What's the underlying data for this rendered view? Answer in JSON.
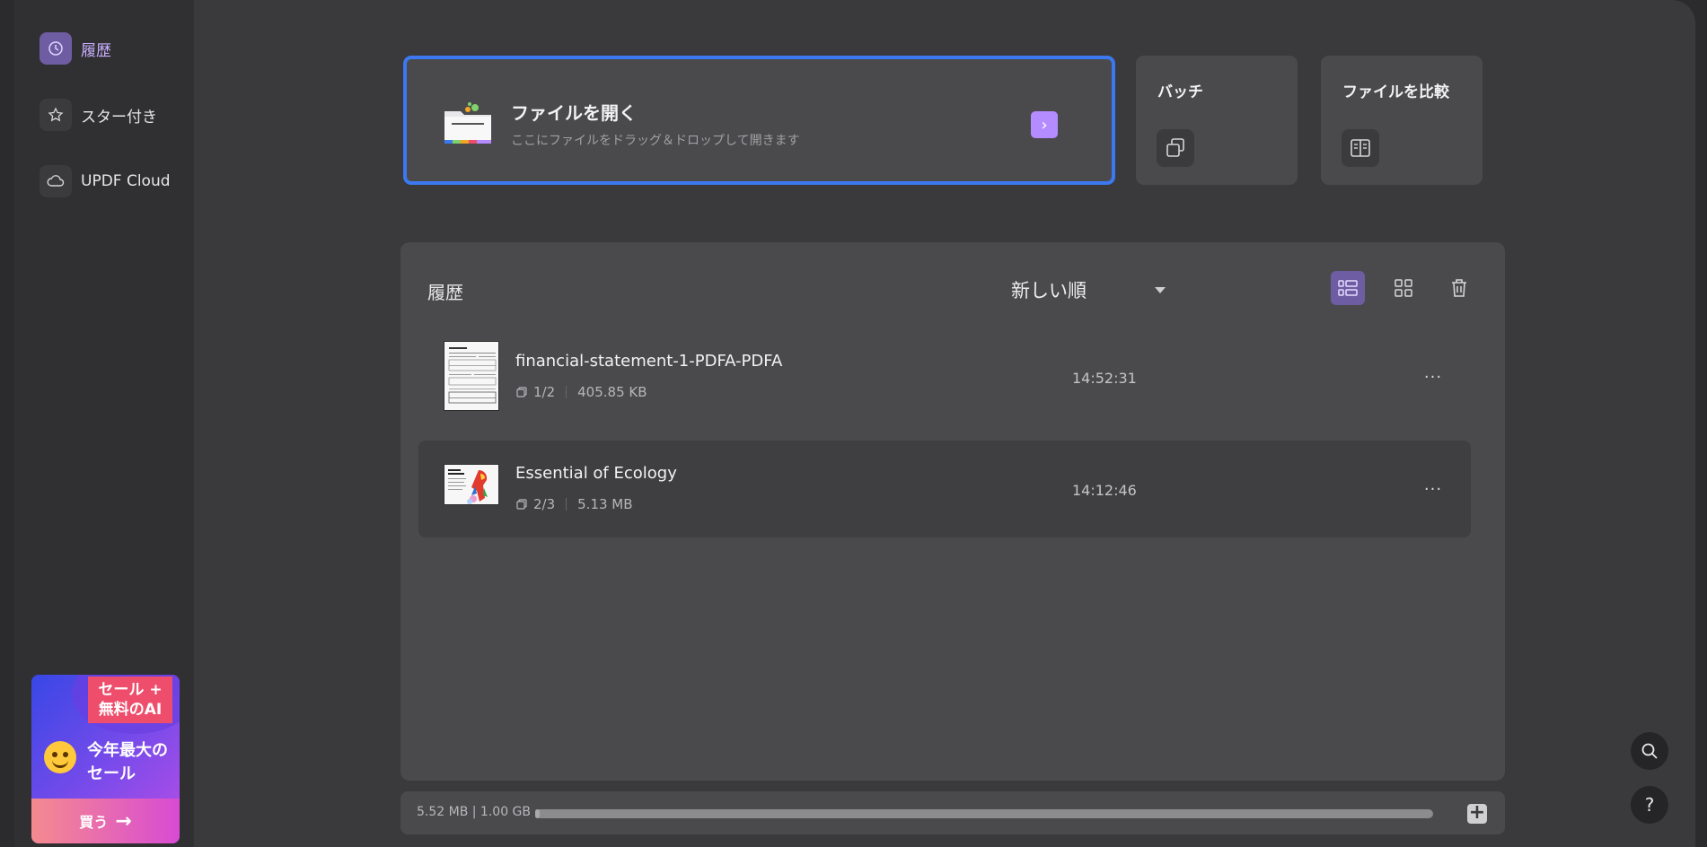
{
  "sidebar": {
    "items": [
      {
        "label": "履歴",
        "icon": "clock-icon",
        "active": true
      },
      {
        "label": "スター付き",
        "icon": "star-icon",
        "active": false
      },
      {
        "label": "UPDF Cloud",
        "icon": "cloud-icon",
        "active": false
      }
    ],
    "promo": {
      "tag": "セール + 無料のAI",
      "title": "今年最大のセール",
      "buy_label": "買う"
    }
  },
  "open_file": {
    "title": "ファイルを開く",
    "subtitle": "ここにファイルをドラッグ＆ドロップして開きます"
  },
  "tools": [
    {
      "label": "バッチ",
      "icon": "batch-icon"
    },
    {
      "label": "ファイルを比較",
      "icon": "compare-icon"
    }
  ],
  "history": {
    "title": "履歴",
    "sort_label": "新しい順",
    "files": [
      {
        "name": "financial-statement-1-PDFA-PDFA",
        "pages": "1/2",
        "size": "405.85 KB",
        "time": "14:52:31",
        "more": "···"
      },
      {
        "name": "Essential of Ecology",
        "pages": "2/3",
        "size": "5.13 MB",
        "time": "14:12:46",
        "more": "···"
      }
    ]
  },
  "storage": {
    "text": "5.52 MB | 1.00 GB",
    "used_fraction": 0.0054
  },
  "help_label": "?",
  "colors": {
    "accent": "#b48cff",
    "active_nav_bg": "#6f5da3",
    "open_card_border": "#3c78f0",
    "panel_bg": "#4a4a4d"
  }
}
